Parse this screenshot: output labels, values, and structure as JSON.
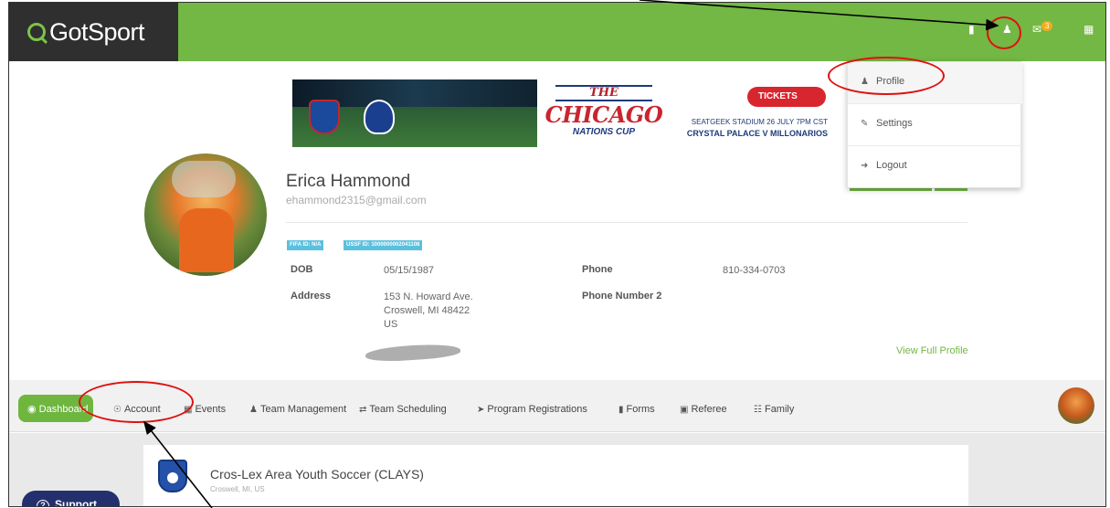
{
  "header": {
    "brand": "GotSport",
    "notification_count": "3"
  },
  "banner": {
    "the": "THE",
    "title": "CHICAGO",
    "subtitle": "NATIONS CUP",
    "tickets": "TICKETS",
    "venue": "SEATGEEK STADIUM 26 JULY 7PM CST",
    "match": "CRYSTAL PALACE V MILLONARIOS"
  },
  "profile": {
    "name": "Erica Hammond",
    "email": "ehammond2315@gmail.com",
    "fifa_id": "FIFA ID: N/A",
    "ussf_id": "USSF ID: 1000000002041108",
    "dob_label": "DOB",
    "dob": "05/15/1987",
    "phone_label": "Phone",
    "phone": "810-334-0703",
    "address_label": "Address",
    "address_line1": "153 N. Howard Ave.",
    "address_line2": "Croswell, MI 48422",
    "address_line3": "US",
    "phone2_label": "Phone Number 2",
    "view_full": "View Full Profile"
  },
  "dropdown": {
    "items": [
      {
        "label": "Profile",
        "icon": "user-icon"
      },
      {
        "label": "Settings",
        "icon": "edit-icon"
      },
      {
        "label": "Logout",
        "icon": "logout-icon"
      }
    ]
  },
  "nav": {
    "items": [
      {
        "label": "Dashboard",
        "icon": "dashboard-icon"
      },
      {
        "label": "Account",
        "icon": "user-circle-icon"
      },
      {
        "label": "Events",
        "icon": "calendar-icon"
      },
      {
        "label": "Team Management",
        "icon": "users-icon"
      },
      {
        "label": "Team Scheduling",
        "icon": "exchange-icon"
      },
      {
        "label": "Program Registrations",
        "icon": "paper-plane-icon"
      },
      {
        "label": "Forms",
        "icon": "file-icon"
      },
      {
        "label": "Referee",
        "icon": "calendar-outline-icon"
      },
      {
        "label": "Family",
        "icon": "sitemap-icon"
      }
    ]
  },
  "club": {
    "name": "Cros-Lex Area Youth Soccer (CLAYS)",
    "location": "Croswell, MI, US"
  },
  "support": {
    "label": "Support"
  },
  "colors": {
    "brand_green": "#73b744",
    "brand_dark": "#2f2f2f",
    "badge_orange": "#f0ad1c",
    "annotation_red": "#e01010",
    "support_navy": "#24306e",
    "tag_blue": "#5bc0de"
  }
}
